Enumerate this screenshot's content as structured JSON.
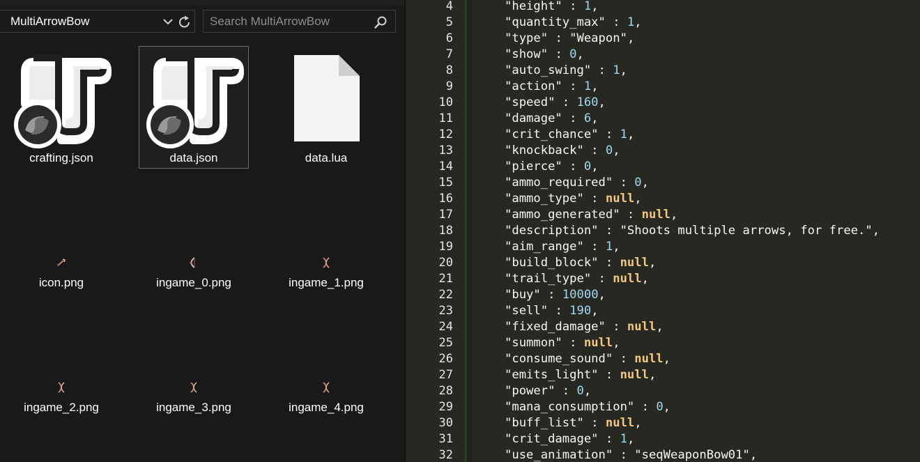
{
  "explorer": {
    "address": "MultiArrowBow",
    "search_placeholder": "Search MultiArrowBow",
    "files": [
      {
        "name": "crafting.json",
        "type": "json",
        "selected": false
      },
      {
        "name": "data.json",
        "type": "json",
        "selected": true
      },
      {
        "name": "data.lua",
        "type": "lua",
        "selected": false
      },
      {
        "name": "icon.png",
        "type": "png",
        "selected": false
      },
      {
        "name": "ingame_0.png",
        "type": "png",
        "selected": false
      },
      {
        "name": "ingame_1.png",
        "type": "png",
        "selected": false
      },
      {
        "name": "ingame_2.png",
        "type": "png",
        "selected": false
      },
      {
        "name": "ingame_3.png",
        "type": "png",
        "selected": false
      },
      {
        "name": "ingame_4.png",
        "type": "png",
        "selected": false
      }
    ]
  },
  "editor": {
    "lines": [
      {
        "n": "4",
        "key": "\"height\"",
        "value": "1",
        "vt": "num",
        "comma": true
      },
      {
        "n": "5",
        "key": "\"quantity_max\"",
        "value": "1",
        "vt": "num",
        "comma": true
      },
      {
        "n": "6",
        "key": "\"type\"",
        "value": "\"Weapon\"",
        "vt": "str",
        "comma": true
      },
      {
        "n": "7",
        "key": "\"show\"",
        "value": "0",
        "vt": "num",
        "comma": true
      },
      {
        "n": "8",
        "key": "\"auto_swing\"",
        "value": "1",
        "vt": "num",
        "comma": true
      },
      {
        "n": "9",
        "key": "\"action\"",
        "value": "1",
        "vt": "num",
        "comma": true
      },
      {
        "n": "10",
        "key": "\"speed\"",
        "value": "160",
        "vt": "num",
        "comma": true
      },
      {
        "n": "11",
        "key": "\"damage\"",
        "value": "6",
        "vt": "num",
        "comma": true
      },
      {
        "n": "12",
        "key": "\"crit_chance\"",
        "value": "1",
        "vt": "num",
        "comma": true
      },
      {
        "n": "13",
        "key": "\"knockback\"",
        "value": "0",
        "vt": "num",
        "comma": true
      },
      {
        "n": "14",
        "key": "\"pierce\"",
        "value": "0",
        "vt": "num",
        "comma": true
      },
      {
        "n": "15",
        "key": "\"ammo_required\"",
        "value": "0",
        "vt": "num",
        "comma": true
      },
      {
        "n": "16",
        "key": "\"ammo_type\"",
        "value": "null",
        "vt": "kw",
        "comma": true
      },
      {
        "n": "17",
        "key": "\"ammo_generated\"",
        "value": "null",
        "vt": "kw",
        "comma": true
      },
      {
        "n": "18",
        "key": "\"description\"",
        "value": "\"Shoots multiple arrows, for free.\"",
        "vt": "str",
        "comma": true
      },
      {
        "n": "19",
        "key": "\"aim_range\"",
        "value": "1",
        "vt": "num",
        "comma": true
      },
      {
        "n": "20",
        "key": "\"build_block\"",
        "value": "null",
        "vt": "kw",
        "comma": true
      },
      {
        "n": "21",
        "key": "\"trail_type\"",
        "value": "null",
        "vt": "kw",
        "comma": true
      },
      {
        "n": "22",
        "key": "\"buy\"",
        "value": "10000",
        "vt": "num",
        "comma": true
      },
      {
        "n": "23",
        "key": "\"sell\"",
        "value": "190",
        "vt": "num",
        "comma": true
      },
      {
        "n": "24",
        "key": "\"fixed_damage\"",
        "value": "null",
        "vt": "kw",
        "comma": true
      },
      {
        "n": "25",
        "key": "\"summon\"",
        "value": "null",
        "vt": "kw",
        "comma": true
      },
      {
        "n": "26",
        "key": "\"consume_sound\"",
        "value": "null",
        "vt": "kw",
        "comma": true
      },
      {
        "n": "27",
        "key": "\"emits_light\"",
        "value": "null",
        "vt": "kw",
        "comma": true
      },
      {
        "n": "28",
        "key": "\"power\"",
        "value": "0",
        "vt": "num",
        "comma": true
      },
      {
        "n": "29",
        "key": "\"mana_consumption\"",
        "value": "0",
        "vt": "num",
        "comma": true
      },
      {
        "n": "30",
        "key": "\"buff_list\"",
        "value": "null",
        "vt": "kw",
        "comma": true
      },
      {
        "n": "31",
        "key": "\"crit_damage\"",
        "value": "1",
        "vt": "num",
        "comma": true
      },
      {
        "n": "32",
        "key": "\"use_animation\"",
        "value": "\"seqWeaponBow01\"",
        "vt": "str",
        "comma": true
      }
    ]
  },
  "colors": {
    "number": "#9fd9f0",
    "keyword": "#f2c780",
    "text": "#f8f8f2",
    "editor_bg": "#272822",
    "explorer_bg": "#191919"
  }
}
